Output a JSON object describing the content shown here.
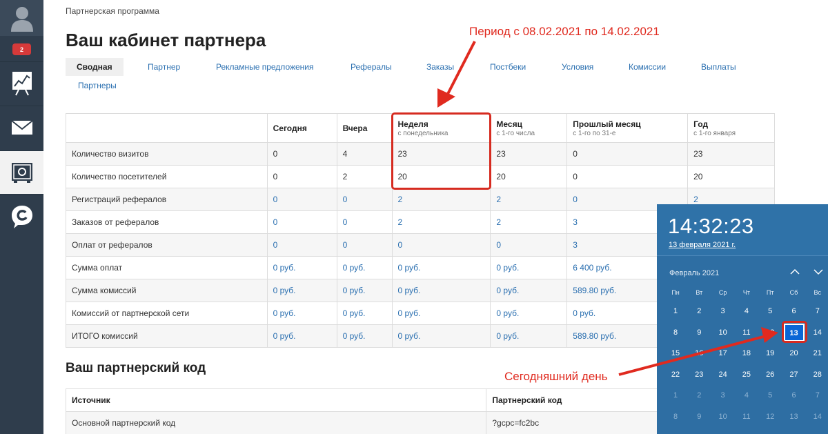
{
  "sidebar": {
    "badge": "2",
    "items": [
      "avatar-icon",
      "chart-icon",
      "mail-icon",
      "safe-icon",
      "chat-icon"
    ]
  },
  "breadcrumb": "Партнерская программа",
  "title": "Ваш кабинет партнера",
  "tabs": [
    "Сводная",
    "Партнер",
    "Рекламные предложения",
    "Рефералы",
    "Заказы",
    "Постбеки",
    "Условия",
    "Комиссии",
    "Выплаты",
    "Партнеры"
  ],
  "stats": {
    "headers": [
      {
        "label": "",
        "sub": ""
      },
      {
        "label": "Сегодня",
        "sub": ""
      },
      {
        "label": "Вчера",
        "sub": ""
      },
      {
        "label": "Неделя",
        "sub": "с понедельника"
      },
      {
        "label": "Месяц",
        "sub": "с 1-го числа"
      },
      {
        "label": "Прошлый месяц",
        "sub": "с 1-го по 31-е"
      },
      {
        "label": "Год",
        "sub": "с 1-го января"
      }
    ],
    "rows": [
      {
        "label": "Количество визитов",
        "values": [
          "0",
          "4",
          "23",
          "23",
          "0",
          "23"
        ],
        "link": false
      },
      {
        "label": "Количество посетителей",
        "values": [
          "0",
          "2",
          "20",
          "20",
          "0",
          "20"
        ],
        "link": false
      },
      {
        "label": "Регистраций рефералов",
        "values": [
          "0",
          "0",
          "2",
          "2",
          "0",
          "2"
        ],
        "link": true
      },
      {
        "label": "Заказов от рефералов",
        "values": [
          "0",
          "0",
          "2",
          "2",
          "3",
          ""
        ],
        "link": true
      },
      {
        "label": "Оплат от рефералов",
        "values": [
          "0",
          "0",
          "0",
          "0",
          "3",
          ""
        ],
        "link": true
      },
      {
        "label": "Сумма оплат",
        "values": [
          "0 руб.",
          "0 руб.",
          "0 руб.",
          "0 руб.",
          "6 400 руб.",
          ""
        ],
        "link": true
      },
      {
        "label": "Сумма комиссий",
        "values": [
          "0 руб.",
          "0 руб.",
          "0 руб.",
          "0 руб.",
          "589.80 руб.",
          ""
        ],
        "link": true
      },
      {
        "label": "Комиссий от партнерской сети",
        "values": [
          "0 руб.",
          "0 руб.",
          "0 руб.",
          "0 руб.",
          "0 руб.",
          ""
        ],
        "link": true
      },
      {
        "label": "ИТОГО комиссий",
        "values": [
          "0 руб.",
          "0 руб.",
          "0 руб.",
          "0 руб.",
          "589.80 руб.",
          ""
        ],
        "link": true
      }
    ]
  },
  "codes": {
    "title": "Ваш партнерский код",
    "headers": [
      "Источник",
      "Партнерский код"
    ],
    "rows": [
      [
        "Основной партнерский код",
        "?gcpc=fc2bc"
      ]
    ]
  },
  "annotations": {
    "period": "Период с 08.02.2021 по 14.02.2021",
    "today": "Сегодняшний день"
  },
  "clock": {
    "time": "14:32:23",
    "date": "13 февраля 2021 г.",
    "month": "Февраль 2021",
    "weekdays": [
      "Пн",
      "Вт",
      "Ср",
      "Чт",
      "Пт",
      "Сб",
      "Вс"
    ],
    "weeks": [
      [
        "1",
        "2",
        "3",
        "4",
        "5",
        "6",
        "7"
      ],
      [
        "8",
        "9",
        "10",
        "11",
        "12",
        "13",
        "14"
      ],
      [
        "15",
        "16",
        "17",
        "18",
        "19",
        "20",
        "21"
      ],
      [
        "22",
        "23",
        "24",
        "25",
        "26",
        "27",
        "28"
      ],
      [
        "1",
        "2",
        "3",
        "4",
        "5",
        "6",
        "7"
      ],
      [
        "8",
        "9",
        "10",
        "11",
        "12",
        "13",
        "14"
      ]
    ],
    "today": "13",
    "colors": {
      "accent": "#0a66d6",
      "annotation": "#e02a1f"
    }
  }
}
